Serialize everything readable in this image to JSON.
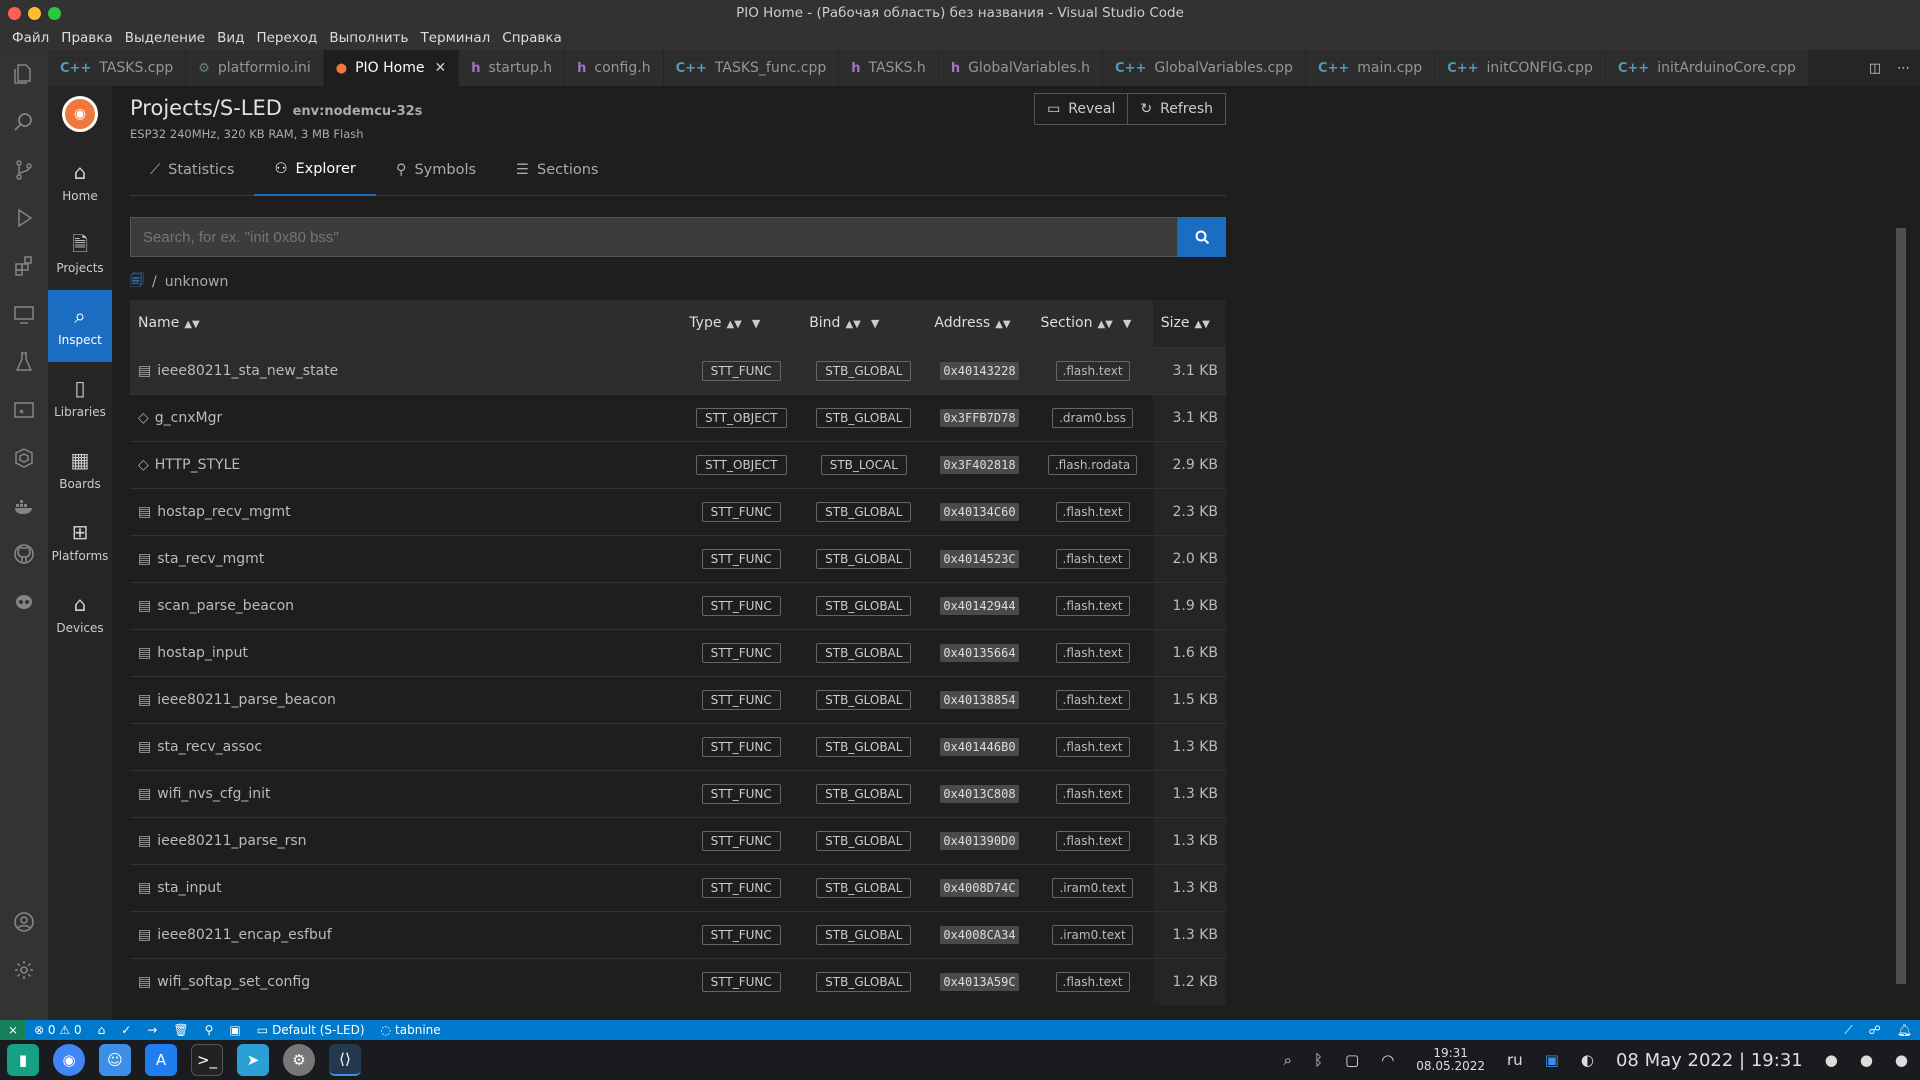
{
  "window": {
    "title": "PIO Home - (Рабочая область) без названия - Visual Studio Code"
  },
  "menu": [
    "Файл",
    "Правка",
    "Выделение",
    "Вид",
    "Переход",
    "Выполнить",
    "Терминал",
    "Справка"
  ],
  "tabs": [
    {
      "icon": "C++",
      "label": "TASKS.cpp"
    },
    {
      "icon": "⚙",
      "label": "platformio.ini"
    },
    {
      "icon": "●",
      "label": "PIO Home"
    },
    {
      "icon": "h",
      "label": "startup.h"
    },
    {
      "icon": "h",
      "label": "config.h"
    },
    {
      "icon": "C++",
      "label": "TASKS_func.cpp"
    },
    {
      "icon": "h",
      "label": "TASKS.h"
    },
    {
      "icon": "h",
      "label": "GlobalVariables.h"
    },
    {
      "icon": "C++",
      "label": "GlobalVariables.cpp"
    },
    {
      "icon": "C++",
      "label": "main.cpp"
    },
    {
      "icon": "C++",
      "label": "initCONFIG.cpp"
    },
    {
      "icon": "C++",
      "label": "initArduinoCore.cpp"
    }
  ],
  "pio_nav": [
    {
      "label": "Home",
      "icon": "home-icon"
    },
    {
      "label": "Projects",
      "icon": "file-icon"
    },
    {
      "label": "Inspect",
      "icon": "inspect-icon"
    },
    {
      "label": "Libraries",
      "icon": "book-icon"
    },
    {
      "label": "Boards",
      "icon": "board-icon"
    },
    {
      "label": "Platforms",
      "icon": "grid-icon"
    },
    {
      "label": "Devices",
      "icon": "device-icon"
    }
  ],
  "project": {
    "title": "Projects/S-LED",
    "env": "env:nodemcu-32s",
    "subtitle": "ESP32 240MHz, 320 KB RAM, 3 MB Flash"
  },
  "buttons": {
    "reveal": "Reveal",
    "refresh": "Refresh"
  },
  "inspect_tabs": [
    "Statistics",
    "Explorer",
    "Symbols",
    "Sections"
  ],
  "search": {
    "placeholder": "Search, for ex. \"init 0x80 bss\""
  },
  "breadcrumb": {
    "sep": "/",
    "current": "unknown"
  },
  "table": {
    "headers": {
      "name": "Name",
      "type": "Type",
      "bind": "Bind",
      "address": "Address",
      "section": "Section",
      "size": "Size"
    },
    "rows": [
      {
        "name": "ieee80211_sta_new_state",
        "type": "STT_FUNC",
        "bind": "STB_GLOBAL",
        "address": "0x40143228",
        "section": ".flash.text",
        "size": "3.1 KB"
      },
      {
        "name": "g_cnxMgr",
        "type": "STT_OBJECT",
        "bind": "STB_GLOBAL",
        "address": "0x3FFB7D78",
        "section": ".dram0.bss",
        "size": "3.1 KB"
      },
      {
        "name": "HTTP_STYLE",
        "type": "STT_OBJECT",
        "bind": "STB_LOCAL",
        "address": "0x3F402818",
        "section": ".flash.rodata",
        "size": "2.9 KB"
      },
      {
        "name": "hostap_recv_mgmt",
        "type": "STT_FUNC",
        "bind": "STB_GLOBAL",
        "address": "0x40134C60",
        "section": ".flash.text",
        "size": "2.3 KB"
      },
      {
        "name": "sta_recv_mgmt",
        "type": "STT_FUNC",
        "bind": "STB_GLOBAL",
        "address": "0x4014523C",
        "section": ".flash.text",
        "size": "2.0 KB"
      },
      {
        "name": "scan_parse_beacon",
        "type": "STT_FUNC",
        "bind": "STB_GLOBAL",
        "address": "0x40142944",
        "section": ".flash.text",
        "size": "1.9 KB"
      },
      {
        "name": "hostap_input",
        "type": "STT_FUNC",
        "bind": "STB_GLOBAL",
        "address": "0x40135664",
        "section": ".flash.text",
        "size": "1.6 KB"
      },
      {
        "name": "ieee80211_parse_beacon",
        "type": "STT_FUNC",
        "bind": "STB_GLOBAL",
        "address": "0x40138854",
        "section": ".flash.text",
        "size": "1.5 KB"
      },
      {
        "name": "sta_recv_assoc",
        "type": "STT_FUNC",
        "bind": "STB_GLOBAL",
        "address": "0x401446B0",
        "section": ".flash.text",
        "size": "1.3 KB"
      },
      {
        "name": "wifi_nvs_cfg_init",
        "type": "STT_FUNC",
        "bind": "STB_GLOBAL",
        "address": "0x4013C808",
        "section": ".flash.text",
        "size": "1.3 KB"
      },
      {
        "name": "ieee80211_parse_rsn",
        "type": "STT_FUNC",
        "bind": "STB_GLOBAL",
        "address": "0x401390D0",
        "section": ".flash.text",
        "size": "1.3 KB"
      },
      {
        "name": "sta_input",
        "type": "STT_FUNC",
        "bind": "STB_GLOBAL",
        "address": "0x4008D74C",
        "section": ".iram0.text",
        "size": "1.3 KB"
      },
      {
        "name": "ieee80211_encap_esfbuf",
        "type": "STT_FUNC",
        "bind": "STB_GLOBAL",
        "address": "0x4008CA34",
        "section": ".iram0.text",
        "size": "1.3 KB"
      },
      {
        "name": "wifi_softap_set_config",
        "type": "STT_FUNC",
        "bind": "STB_GLOBAL",
        "address": "0x4013A59C",
        "section": ".flash.text",
        "size": "1.2 KB"
      }
    ]
  },
  "status": {
    "problems": "⊗ 0 ⚠ 0",
    "env": "Default (S-LED)",
    "tabnine": "tabnine"
  },
  "taskbar": {
    "time_small": "19:31",
    "date_small": "08.05.2022",
    "lang": "ru",
    "datetime": "08 May 2022 | 19:31"
  },
  "colors": {
    "accent": "#1b6dc1",
    "statusbar": "#007acc",
    "pio_orange": "#f0783c"
  }
}
